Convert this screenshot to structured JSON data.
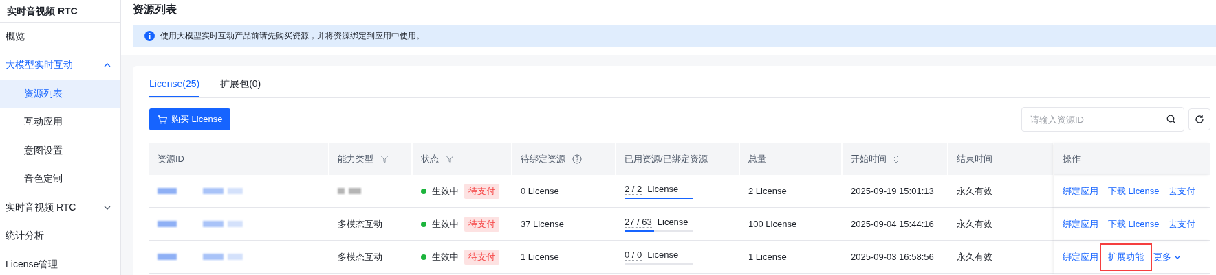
{
  "sidebar": {
    "title": "实时音视频 RTC",
    "items": [
      {
        "label": "概览",
        "selected": false
      },
      {
        "label": "大模型实时互动",
        "selected": false,
        "expanded": true,
        "children": [
          {
            "label": "资源列表",
            "selected": true
          },
          {
            "label": "互动应用",
            "selected": false
          },
          {
            "label": "意图设置",
            "selected": false
          },
          {
            "label": "音色定制",
            "selected": false
          }
        ]
      },
      {
        "label": "实时音视频 RTC",
        "selected": false,
        "expanded": false
      },
      {
        "label": "统计分析",
        "selected": false
      },
      {
        "label": "License管理",
        "selected": false
      }
    ]
  },
  "page_title": "资源列表",
  "notice": "使用大模型实时互动产品前请先购买资源，并将资源绑定到应用中使用。",
  "tabs": [
    {
      "label": "License(25)",
      "selected": true
    },
    {
      "label": "扩展包(0)",
      "selected": false
    }
  ],
  "buy_button": "购买 License",
  "search": {
    "placeholder": "请输入资源ID"
  },
  "table": {
    "columns": [
      {
        "label": "资源ID"
      },
      {
        "label": "能力类型",
        "filter": true
      },
      {
        "label": "状态",
        "filter": true
      },
      {
        "label": "待绑定资源",
        "help": true
      },
      {
        "label": "已用资源/已绑定资源"
      },
      {
        "label": "总量"
      },
      {
        "label": "开始时间",
        "sort": true
      },
      {
        "label": "结束时间"
      },
      {
        "label": "操作"
      }
    ],
    "rows": [
      {
        "status": "生效中",
        "color": "#1cb43c",
        "tag": "待支付",
        "pending": "0 License",
        "used": "2 / 2",
        "used_unit": "License",
        "level": 1,
        "total": "2 License",
        "start": "2025-09-19 15:01:13",
        "end": "永久有效",
        "actions": [
          {
            "label": "绑定应用",
            "kind": "link",
            "highlighted": false
          },
          {
            "label": "下载 License",
            "kind": "link",
            "highlighted": false
          },
          {
            "label": "去支付",
            "kind": "link",
            "highlighted": false
          }
        ]
      },
      {
        "capability": "多模态互动",
        "status": "生效中",
        "color": "#1cb43c",
        "tag": "待支付",
        "pending": "37 License",
        "used": "27 / 63",
        "used_unit": "License",
        "level": 0.43,
        "total": "100 License",
        "start": "2025-09-04 15:44:16",
        "end": "永久有效",
        "actions": [
          {
            "label": "绑定应用",
            "kind": "link",
            "highlighted": false
          },
          {
            "label": "下载 License",
            "kind": "link",
            "highlighted": false
          },
          {
            "label": "去支付",
            "kind": "link",
            "highlighted": false
          }
        ]
      },
      {
        "capability": "多模态互动",
        "status": "生效中",
        "color": "#1cb43c",
        "tag": "待支付",
        "pending": "1 License",
        "used": "0 / 0",
        "used_unit": "License",
        "level": 0,
        "total": "1 License",
        "start": "2025-09-03 16:58:56",
        "end": "永久有效",
        "actions": [
          {
            "label": "绑定应用",
            "kind": "link",
            "highlighted": false
          },
          {
            "label": "扩展功能",
            "kind": "link",
            "highlighted": true
          },
          {
            "label": "更多",
            "kind": "dropdown",
            "highlighted": false
          }
        ]
      }
    ]
  }
}
